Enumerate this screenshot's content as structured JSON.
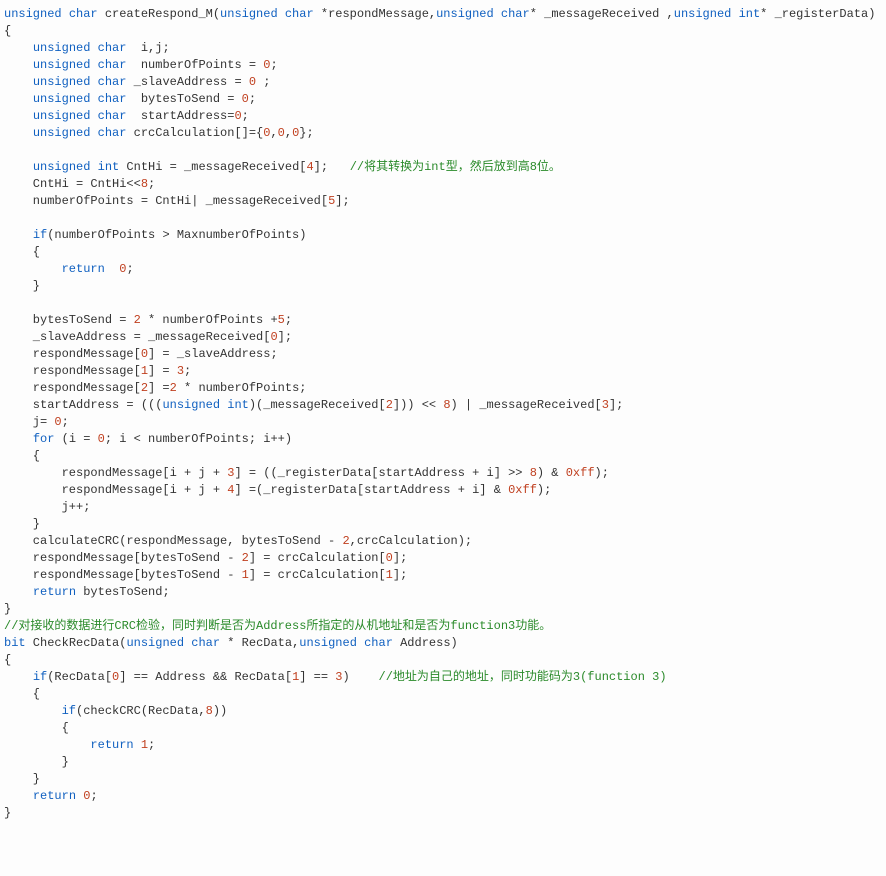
{
  "code_lines": [
    [
      [
        "k",
        "unsigned"
      ],
      [
        "p",
        " "
      ],
      [
        "k",
        "char"
      ],
      [
        "p",
        " createRespond_M("
      ],
      [
        "k",
        "unsigned"
      ],
      [
        "p",
        " "
      ],
      [
        "k",
        "char"
      ],
      [
        "p",
        " *respondMessage,"
      ],
      [
        "k",
        "unsigned"
      ],
      [
        "p",
        " "
      ],
      [
        "k",
        "char"
      ],
      [
        "p",
        "* _messageReceived ,"
      ],
      [
        "k",
        "unsigned"
      ],
      [
        "p",
        " "
      ],
      [
        "k",
        "int"
      ],
      [
        "p",
        "* _registerData)"
      ]
    ],
    [
      [
        "p",
        "{"
      ]
    ],
    [
      [
        "p",
        "    "
      ],
      [
        "k",
        "unsigned"
      ],
      [
        "p",
        " "
      ],
      [
        "k",
        "char"
      ],
      [
        "p",
        "  i,j;"
      ]
    ],
    [
      [
        "p",
        "    "
      ],
      [
        "k",
        "unsigned"
      ],
      [
        "p",
        " "
      ],
      [
        "k",
        "char"
      ],
      [
        "p",
        "  numberOfPoints = "
      ],
      [
        "n",
        "0"
      ],
      [
        "p",
        ";"
      ]
    ],
    [
      [
        "p",
        "    "
      ],
      [
        "k",
        "unsigned"
      ],
      [
        "p",
        " "
      ],
      [
        "k",
        "char"
      ],
      [
        "p",
        " _slaveAddress = "
      ],
      [
        "n",
        "0"
      ],
      [
        "p",
        " ;"
      ]
    ],
    [
      [
        "p",
        "    "
      ],
      [
        "k",
        "unsigned"
      ],
      [
        "p",
        " "
      ],
      [
        "k",
        "char"
      ],
      [
        "p",
        "  bytesToSend = "
      ],
      [
        "n",
        "0"
      ],
      [
        "p",
        ";"
      ]
    ],
    [
      [
        "p",
        "    "
      ],
      [
        "k",
        "unsigned"
      ],
      [
        "p",
        " "
      ],
      [
        "k",
        "char"
      ],
      [
        "p",
        "  startAddress="
      ],
      [
        "n",
        "0"
      ],
      [
        "p",
        ";"
      ]
    ],
    [
      [
        "p",
        "    "
      ],
      [
        "k",
        "unsigned"
      ],
      [
        "p",
        " "
      ],
      [
        "k",
        "char"
      ],
      [
        "p",
        " crcCalculation[]={"
      ],
      [
        "n",
        "0"
      ],
      [
        "p",
        ","
      ],
      [
        "n",
        "0"
      ],
      [
        "p",
        ","
      ],
      [
        "n",
        "0"
      ],
      [
        "p",
        "};"
      ]
    ],
    [
      [
        "p",
        ""
      ]
    ],
    [
      [
        "p",
        "    "
      ],
      [
        "k",
        "unsigned"
      ],
      [
        "p",
        " "
      ],
      [
        "k",
        "int"
      ],
      [
        "p",
        " CntHi = _messageReceived["
      ],
      [
        "n",
        "4"
      ],
      [
        "p",
        "];   "
      ],
      [
        "c",
        "//将其转换为int型，然后放到高8位。"
      ]
    ],
    [
      [
        "p",
        "    CntHi = CntHi<<"
      ],
      [
        "n",
        "8"
      ],
      [
        "p",
        ";"
      ]
    ],
    [
      [
        "p",
        "    numberOfPoints = CntHi| _messageReceived["
      ],
      [
        "n",
        "5"
      ],
      [
        "p",
        "];"
      ]
    ],
    [
      [
        "p",
        ""
      ]
    ],
    [
      [
        "p",
        "    "
      ],
      [
        "k",
        "if"
      ],
      [
        "p",
        "(numberOfPoints > MaxnumberOfPoints)"
      ]
    ],
    [
      [
        "p",
        "    {"
      ]
    ],
    [
      [
        "p",
        "        "
      ],
      [
        "k",
        "return"
      ],
      [
        "p",
        "  "
      ],
      [
        "n",
        "0"
      ],
      [
        "p",
        ";"
      ]
    ],
    [
      [
        "p",
        "    }"
      ]
    ],
    [
      [
        "p",
        ""
      ]
    ],
    [
      [
        "p",
        "    bytesToSend = "
      ],
      [
        "n",
        "2"
      ],
      [
        "p",
        " * numberOfPoints +"
      ],
      [
        "n",
        "5"
      ],
      [
        "p",
        ";"
      ]
    ],
    [
      [
        "p",
        "    _slaveAddress = _messageReceived["
      ],
      [
        "n",
        "0"
      ],
      [
        "p",
        "];"
      ]
    ],
    [
      [
        "p",
        "    respondMessage["
      ],
      [
        "n",
        "0"
      ],
      [
        "p",
        "] = _slaveAddress;"
      ]
    ],
    [
      [
        "p",
        "    respondMessage["
      ],
      [
        "n",
        "1"
      ],
      [
        "p",
        "] = "
      ],
      [
        "n",
        "3"
      ],
      [
        "p",
        ";"
      ]
    ],
    [
      [
        "p",
        "    respondMessage["
      ],
      [
        "n",
        "2"
      ],
      [
        "p",
        "] ="
      ],
      [
        "n",
        "2"
      ],
      [
        "p",
        " * numberOfPoints;"
      ]
    ],
    [
      [
        "p",
        "    startAddress = ((("
      ],
      [
        "k",
        "unsigned"
      ],
      [
        "p",
        " "
      ],
      [
        "k",
        "int"
      ],
      [
        "p",
        ")(_messageReceived["
      ],
      [
        "n",
        "2"
      ],
      [
        "p",
        "])) << "
      ],
      [
        "n",
        "8"
      ],
      [
        "p",
        ") | _messageReceived["
      ],
      [
        "n",
        "3"
      ],
      [
        "p",
        "];"
      ]
    ],
    [
      [
        "p",
        "    j= "
      ],
      [
        "n",
        "0"
      ],
      [
        "p",
        ";"
      ]
    ],
    [
      [
        "p",
        "    "
      ],
      [
        "k",
        "for"
      ],
      [
        "p",
        " (i = "
      ],
      [
        "n",
        "0"
      ],
      [
        "p",
        "; i < numberOfPoints; i++)"
      ]
    ],
    [
      [
        "p",
        "    {"
      ]
    ],
    [
      [
        "p",
        "        respondMessage[i + j + "
      ],
      [
        "n",
        "3"
      ],
      [
        "p",
        "] = ((_registerData[startAddress + i] >> "
      ],
      [
        "n",
        "8"
      ],
      [
        "p",
        ") & "
      ],
      [
        "n",
        "0xff"
      ],
      [
        "p",
        ");"
      ]
    ],
    [
      [
        "p",
        "        respondMessage[i + j + "
      ],
      [
        "n",
        "4"
      ],
      [
        "p",
        "] =(_registerData[startAddress + i] & "
      ],
      [
        "n",
        "0xff"
      ],
      [
        "p",
        ");"
      ]
    ],
    [
      [
        "p",
        "        j++;"
      ]
    ],
    [
      [
        "p",
        "    }"
      ]
    ],
    [
      [
        "p",
        "    calculateCRC(respondMessage, bytesToSend - "
      ],
      [
        "n",
        "2"
      ],
      [
        "p",
        ",crcCalculation);"
      ]
    ],
    [
      [
        "p",
        "    respondMessage[bytesToSend - "
      ],
      [
        "n",
        "2"
      ],
      [
        "p",
        "] = crcCalculation["
      ],
      [
        "n",
        "0"
      ],
      [
        "p",
        "];"
      ]
    ],
    [
      [
        "p",
        "    respondMessage[bytesToSend - "
      ],
      [
        "n",
        "1"
      ],
      [
        "p",
        "] = crcCalculation["
      ],
      [
        "n",
        "1"
      ],
      [
        "p",
        "];"
      ]
    ],
    [
      [
        "p",
        "    "
      ],
      [
        "k",
        "return"
      ],
      [
        "p",
        " bytesToSend;"
      ]
    ],
    [
      [
        "p",
        "}"
      ]
    ],
    [
      [
        "c",
        "//对接收的数据进行CRC检验，同时判断是否为Address所指定的从机地址和是否为function3功能。"
      ]
    ],
    [
      [
        "k",
        "bit"
      ],
      [
        "p",
        " CheckRecData("
      ],
      [
        "k",
        "unsigned"
      ],
      [
        "p",
        " "
      ],
      [
        "k",
        "char"
      ],
      [
        "p",
        " * RecData,"
      ],
      [
        "k",
        "unsigned"
      ],
      [
        "p",
        " "
      ],
      [
        "k",
        "char"
      ],
      [
        "p",
        " Address)"
      ]
    ],
    [
      [
        "p",
        "{"
      ]
    ],
    [
      [
        "p",
        "    "
      ],
      [
        "k",
        "if"
      ],
      [
        "p",
        "(RecData["
      ],
      [
        "n",
        "0"
      ],
      [
        "p",
        "] == Address && RecData["
      ],
      [
        "n",
        "1"
      ],
      [
        "p",
        "] == "
      ],
      [
        "n",
        "3"
      ],
      [
        "p",
        ")    "
      ],
      [
        "c",
        "//地址为自己的地址，同时功能码为3(function 3)"
      ]
    ],
    [
      [
        "p",
        "    {"
      ]
    ],
    [
      [
        "p",
        "        "
      ],
      [
        "k",
        "if"
      ],
      [
        "p",
        "(checkCRC(RecData,"
      ],
      [
        "n",
        "8"
      ],
      [
        "p",
        "))"
      ]
    ],
    [
      [
        "p",
        "        {"
      ]
    ],
    [
      [
        "p",
        "            "
      ],
      [
        "k",
        "return"
      ],
      [
        "p",
        " "
      ],
      [
        "n",
        "1"
      ],
      [
        "p",
        ";"
      ]
    ],
    [
      [
        "p",
        "        }"
      ]
    ],
    [
      [
        "p",
        "    }"
      ]
    ],
    [
      [
        "p",
        "    "
      ],
      [
        "k",
        "return"
      ],
      [
        "p",
        " "
      ],
      [
        "n",
        "0"
      ],
      [
        "p",
        ";"
      ]
    ],
    [
      [
        "p",
        "}"
      ]
    ]
  ]
}
